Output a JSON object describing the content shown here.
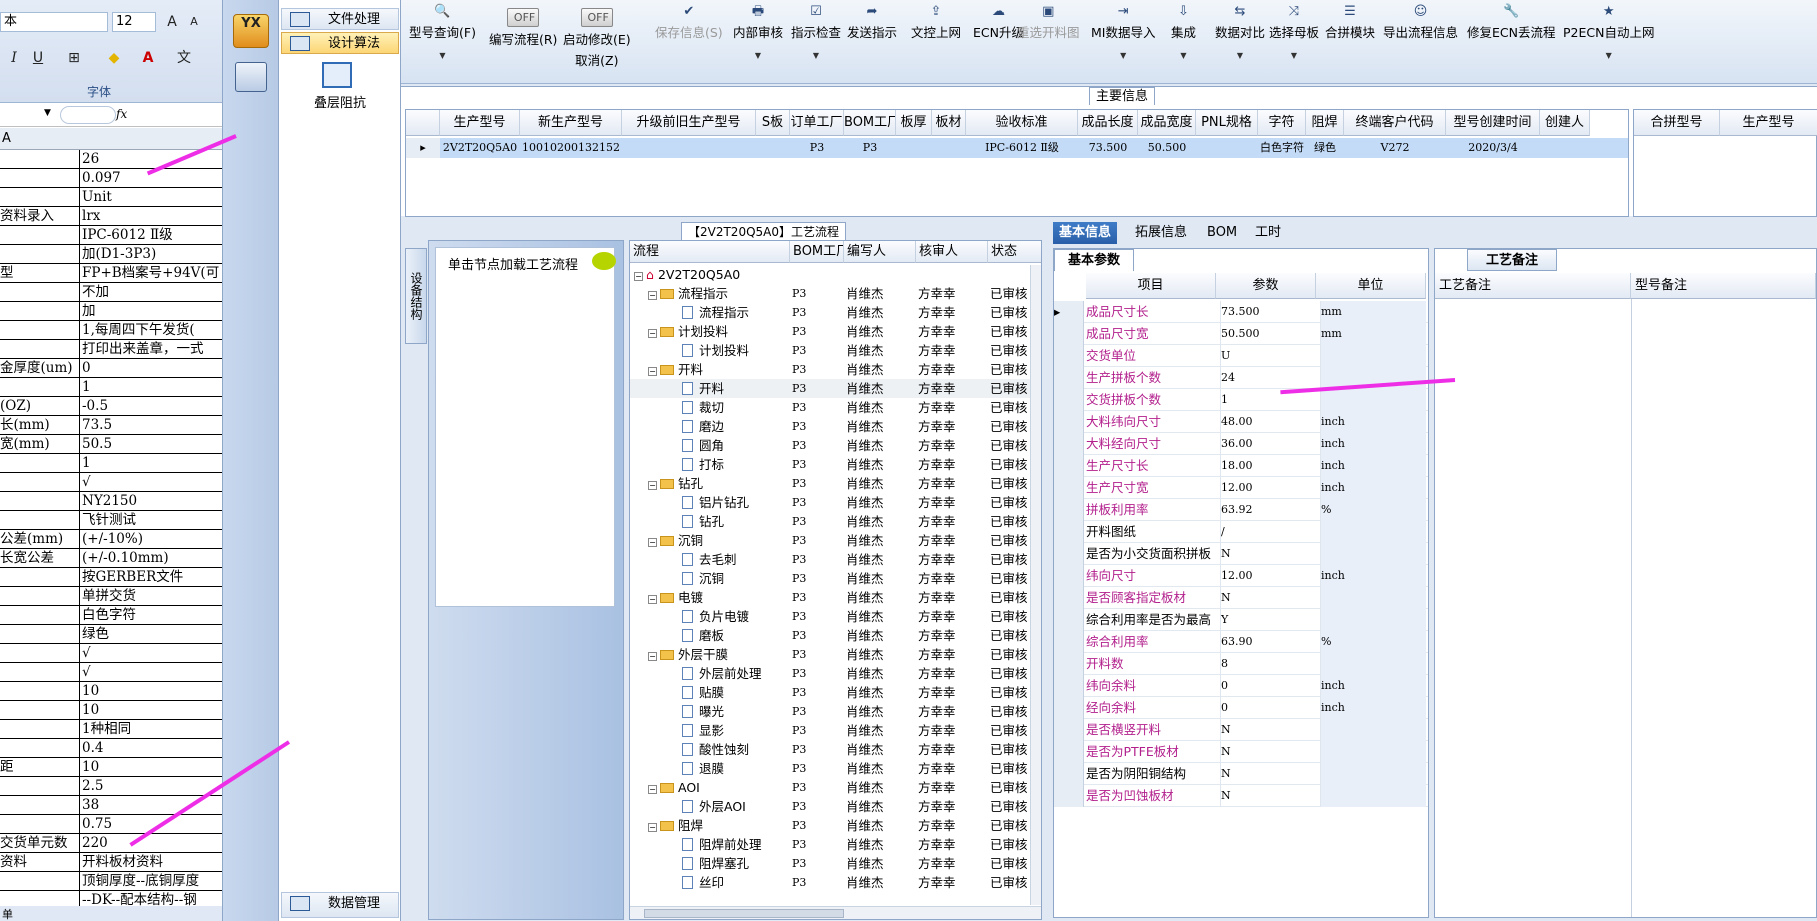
{
  "excel": {
    "font_name": "本",
    "font_size": "12",
    "font_group_label": "字体",
    "col_header": "A",
    "rows": [
      {
        "a": "",
        "b": "26"
      },
      {
        "a": "",
        "b": "0.097"
      },
      {
        "a": "",
        "b": "Unit"
      },
      {
        "a": "资料录入",
        "b": "lrx"
      },
      {
        "a": "",
        "b": "IPC-6012 Ⅱ级"
      },
      {
        "a": "",
        "b": "加(D1-3P3)"
      },
      {
        "a": "型",
        "b": "FP+B档案号+94V(可"
      },
      {
        "a": "",
        "b": "不加"
      },
      {
        "a": "",
        "b": "加"
      },
      {
        "a": "",
        "b": "1,每周四下午发货("
      },
      {
        "a": "",
        "b": "打印出来盖章，一式"
      },
      {
        "a": "金厚度(um)",
        "b": "0"
      },
      {
        "a": "",
        "b": "1"
      },
      {
        "a": "(OZ)",
        "b": "-0.5"
      },
      {
        "a": "长(mm)",
        "b": "73.5"
      },
      {
        "a": "宽(mm)",
        "b": "50.5"
      },
      {
        "a": "",
        "b": "1"
      },
      {
        "a": "",
        "b": "√"
      },
      {
        "a": "",
        "b": "NY2150"
      },
      {
        "a": "",
        "b": "飞针测试"
      },
      {
        "a": "公差(mm)",
        "b": "(+/-10%)"
      },
      {
        "a": "长宽公差",
        "b": "(+/-0.10mm)"
      },
      {
        "a": "",
        "b": "按GERBER文件"
      },
      {
        "a": "",
        "b": "单拼交货"
      },
      {
        "a": "",
        "b": "白色字符"
      },
      {
        "a": "",
        "b": "绿色"
      },
      {
        "a": "",
        "b": "√"
      },
      {
        "a": "",
        "b": "√"
      },
      {
        "a": "",
        "b": "10"
      },
      {
        "a": "",
        "b": "10"
      },
      {
        "a": "",
        "b": "1种相同"
      },
      {
        "a": "",
        "b": "0.4"
      },
      {
        "a": "距",
        "b": "10"
      },
      {
        "a": "",
        "b": "2.5"
      },
      {
        "a": "",
        "b": "38"
      },
      {
        "a": "",
        "b": "0.75"
      },
      {
        "a": "交货单元数",
        "b": "220"
      },
      {
        "a": "资料",
        "b": "开料板材资料"
      },
      {
        "a": "",
        "b": "顶铜厚度--底铜厚度"
      },
      {
        "a": "",
        "b": "--DK--配本结构--钢"
      }
    ],
    "sheet_tab": "单"
  },
  "nav": {
    "items": [
      "文件处理",
      "设计算法"
    ],
    "sub_item": "叠层阻抗",
    "bottom_item": "数据管理",
    "logo_text": "YX"
  },
  "toolbar": {
    "buttons": [
      {
        "icon": "🔍",
        "label": "型号查询(F)",
        "dd": true,
        "dis": false
      },
      {
        "icon": "",
        "label": "编写流程(R)",
        "dd": false,
        "dis": false,
        "toggle": "OFF"
      },
      {
        "icon": "",
        "label": "启动修改(E)",
        "sub": "取消(Z)",
        "dd": false,
        "dis": false,
        "toggle": "OFF"
      },
      {
        "icon": "✔",
        "label": "保存信息(S)",
        "dd": false,
        "dis": true
      },
      {
        "icon": "🖶",
        "label": "内部审核",
        "dd": true,
        "dis": false
      },
      {
        "icon": "☑",
        "label": "指示检查",
        "dd": true,
        "dis": false
      },
      {
        "icon": "➦",
        "label": "发送指示",
        "dd": false,
        "dis": false
      },
      {
        "icon": "⇪",
        "label": "文控上网",
        "dd": false,
        "dis": false
      },
      {
        "icon": "☁",
        "label": "ECN升级",
        "dd": false,
        "dis": false
      },
      {
        "icon": "▣",
        "label": "重选开料图",
        "dd": false,
        "dis": true
      },
      {
        "icon": "⇥",
        "label": "MI数据导入",
        "dd": true,
        "dis": false
      },
      {
        "icon": "⇩",
        "label": "集成",
        "dd": true,
        "dis": false
      },
      {
        "icon": "⇆",
        "label": "数据对比",
        "dd": true,
        "dis": false
      },
      {
        "icon": "⤨",
        "label": "选择母板",
        "dd": true,
        "dis": false
      },
      {
        "icon": "☰",
        "label": "合拼模块",
        "dd": false,
        "dis": false
      },
      {
        "icon": "☺",
        "label": "导出流程信息",
        "dd": false,
        "dis": false
      },
      {
        "icon": "🔧",
        "label": "修复ECN丢流程",
        "dd": false,
        "dis": false
      },
      {
        "icon": "★",
        "label": "P2ECN自动上网",
        "dd": true,
        "dis": false
      }
    ]
  },
  "main_info": {
    "title": "主要信息",
    "columns": [
      "生产型号",
      "新生产型号",
      "升级前旧生产型号",
      "S板",
      "订单工厂",
      "BOM工厂",
      "板厚",
      "板材",
      "验收标准",
      "成品长度",
      "成品宽度",
      "PNL规格",
      "字符",
      "阻焊",
      "终端客户代码",
      "型号创建时间",
      "创建人"
    ],
    "row": [
      "2V2T20Q5A0",
      "10010200132152",
      "",
      "",
      "P3",
      "P3",
      "",
      "",
      "IPC-6012 Ⅱ级",
      "73.500",
      "50.500",
      "",
      "白色字符",
      "绿色",
      "V272",
      "2020/3/4",
      ""
    ],
    "right_columns": [
      "合拼型号",
      "生产型号"
    ]
  },
  "process": {
    "vtab_label": "设备结构",
    "load_hint": "单击节点加载工艺流程",
    "title": "【2V2T20Q5A0】工艺流程",
    "columns": [
      "流程",
      "BOM工厂",
      "编写人",
      "核审人",
      "状态"
    ],
    "root": "2V2T20Q5A0",
    "rows": [
      {
        "name": "流程指示",
        "lvl": 1,
        "folder": true,
        "bom": "P3",
        "w": "肖维杰",
        "r": "方幸幸",
        "s": "已审核"
      },
      {
        "name": "流程指示",
        "lvl": 2,
        "folder": false,
        "bom": "P3",
        "w": "肖维杰",
        "r": "方幸幸",
        "s": "已审核"
      },
      {
        "name": "计划投料",
        "lvl": 1,
        "folder": true,
        "bom": "P3",
        "w": "肖维杰",
        "r": "方幸幸",
        "s": "已审核"
      },
      {
        "name": "计划投料",
        "lvl": 2,
        "folder": false,
        "bom": "P3",
        "w": "肖维杰",
        "r": "方幸幸",
        "s": "已审核"
      },
      {
        "name": "开料",
        "lvl": 1,
        "folder": true,
        "bom": "P3",
        "w": "肖维杰",
        "r": "方幸幸",
        "s": "已审核"
      },
      {
        "name": "开料",
        "lvl": 2,
        "folder": false,
        "bom": "P3",
        "w": "肖维杰",
        "r": "方幸幸",
        "s": "已审核"
      },
      {
        "name": "裁切",
        "lvl": 2,
        "folder": false,
        "bom": "P3",
        "w": "肖维杰",
        "r": "方幸幸",
        "s": "已审核"
      },
      {
        "name": "磨边",
        "lvl": 2,
        "folder": false,
        "bom": "P3",
        "w": "肖维杰",
        "r": "方幸幸",
        "s": "已审核"
      },
      {
        "name": "圆角",
        "lvl": 2,
        "folder": false,
        "bom": "P3",
        "w": "肖维杰",
        "r": "方幸幸",
        "s": "已审核"
      },
      {
        "name": "打标",
        "lvl": 2,
        "folder": false,
        "bom": "P3",
        "w": "肖维杰",
        "r": "方幸幸",
        "s": "已审核"
      },
      {
        "name": "钻孔",
        "lvl": 1,
        "folder": true,
        "bom": "P3",
        "w": "肖维杰",
        "r": "方幸幸",
        "s": "已审核"
      },
      {
        "name": "铝片钻孔",
        "lvl": 2,
        "folder": false,
        "bom": "P3",
        "w": "肖维杰",
        "r": "方幸幸",
        "s": "已审核"
      },
      {
        "name": "钻孔",
        "lvl": 2,
        "folder": false,
        "bom": "P3",
        "w": "肖维杰",
        "r": "方幸幸",
        "s": "已审核"
      },
      {
        "name": "沉铜",
        "lvl": 1,
        "folder": true,
        "bom": "P3",
        "w": "肖维杰",
        "r": "方幸幸",
        "s": "已审核"
      },
      {
        "name": "去毛刺",
        "lvl": 2,
        "folder": false,
        "bom": "P3",
        "w": "肖维杰",
        "r": "方幸幸",
        "s": "已审核"
      },
      {
        "name": "沉铜",
        "lvl": 2,
        "folder": false,
        "bom": "P3",
        "w": "肖维杰",
        "r": "方幸幸",
        "s": "已审核"
      },
      {
        "name": "电镀",
        "lvl": 1,
        "folder": true,
        "bom": "P3",
        "w": "肖维杰",
        "r": "方幸幸",
        "s": "已审核"
      },
      {
        "name": "负片电镀",
        "lvl": 2,
        "folder": false,
        "bom": "P3",
        "w": "肖维杰",
        "r": "方幸幸",
        "s": "已审核"
      },
      {
        "name": "磨板",
        "lvl": 2,
        "folder": false,
        "bom": "P3",
        "w": "肖维杰",
        "r": "方幸幸",
        "s": "已审核"
      },
      {
        "name": "外层干膜",
        "lvl": 1,
        "folder": true,
        "bom": "P3",
        "w": "肖维杰",
        "r": "方幸幸",
        "s": "已审核"
      },
      {
        "name": "外层前处理",
        "lvl": 2,
        "folder": false,
        "bom": "P3",
        "w": "肖维杰",
        "r": "方幸幸",
        "s": "已审核"
      },
      {
        "name": "贴膜",
        "lvl": 2,
        "folder": false,
        "bom": "P3",
        "w": "肖维杰",
        "r": "方幸幸",
        "s": "已审核"
      },
      {
        "name": "曝光",
        "lvl": 2,
        "folder": false,
        "bom": "P3",
        "w": "肖维杰",
        "r": "方幸幸",
        "s": "已审核"
      },
      {
        "name": "显影",
        "lvl": 2,
        "folder": false,
        "bom": "P3",
        "w": "肖维杰",
        "r": "方幸幸",
        "s": "已审核"
      },
      {
        "name": "酸性蚀刻",
        "lvl": 2,
        "folder": false,
        "bom": "P3",
        "w": "肖维杰",
        "r": "方幸幸",
        "s": "已审核"
      },
      {
        "name": "退膜",
        "lvl": 2,
        "folder": false,
        "bom": "P3",
        "w": "肖维杰",
        "r": "方幸幸",
        "s": "已审核"
      },
      {
        "name": "AOI",
        "lvl": 1,
        "folder": true,
        "bom": "P3",
        "w": "肖维杰",
        "r": "方幸幸",
        "s": "已审核"
      },
      {
        "name": "外层AOI",
        "lvl": 2,
        "folder": false,
        "bom": "P3",
        "w": "肖维杰",
        "r": "方幸幸",
        "s": "已审核"
      },
      {
        "name": "阻焊",
        "lvl": 1,
        "folder": true,
        "bom": "P3",
        "w": "肖维杰",
        "r": "方幸幸",
        "s": "已审核"
      },
      {
        "name": "阻焊前处理",
        "lvl": 2,
        "folder": false,
        "bom": "P3",
        "w": "肖维杰",
        "r": "方幸幸",
        "s": "已审核"
      },
      {
        "name": "阻焊塞孔",
        "lvl": 2,
        "folder": false,
        "bom": "P3",
        "w": "肖维杰",
        "r": "方幸幸",
        "s": "已审核"
      },
      {
        "name": "丝印",
        "lvl": 2,
        "folder": false,
        "bom": "P3",
        "w": "肖维杰",
        "r": "方幸幸",
        "s": "已审核"
      }
    ]
  },
  "basic": {
    "tabs": [
      "基本信息",
      "拓展信息",
      "BOM",
      "工时"
    ],
    "sub_tab": "基本参数",
    "columns": [
      "项目",
      "参数",
      "单位"
    ],
    "rows": [
      {
        "k": "成品尺寸长",
        "v": "73.500",
        "u": "mm",
        "pink": true
      },
      {
        "k": "成品尺寸宽",
        "v": "50.500",
        "u": "mm",
        "pink": true
      },
      {
        "k": "交货单位",
        "v": "U",
        "u": "",
        "pink": true
      },
      {
        "k": "生产拼板个数",
        "v": "24",
        "u": "",
        "pink": true
      },
      {
        "k": "交货拼板个数",
        "v": "1",
        "u": "",
        "pink": true
      },
      {
        "k": "大料纬向尺寸",
        "v": "48.00",
        "u": "inch",
        "pink": true
      },
      {
        "k": "大料经向尺寸",
        "v": "36.00",
        "u": "inch",
        "pink": true
      },
      {
        "k": "生产尺寸长",
        "v": "18.00",
        "u": "inch",
        "pink": true
      },
      {
        "k": "生产尺寸宽",
        "v": "12.00",
        "u": "inch",
        "pink": true
      },
      {
        "k": "拼板利用率",
        "v": "63.92",
        "u": "%",
        "pink": true
      },
      {
        "k": "开料图纸",
        "v": "/",
        "u": "",
        "pink": false
      },
      {
        "k": "是否为小交货面积拼板",
        "v": "N",
        "u": "",
        "pink": false
      },
      {
        "k": "纬向尺寸",
        "v": "12.00",
        "u": "inch",
        "pink": true
      },
      {
        "k": "是否顾客指定板材",
        "v": "N",
        "u": "",
        "pink": true
      },
      {
        "k": "综合利用率是否为最高",
        "v": "Y",
        "u": "",
        "pink": false
      },
      {
        "k": "综合利用率",
        "v": "63.90",
        "u": "%",
        "pink": true
      },
      {
        "k": "开料数",
        "v": "8",
        "u": "",
        "pink": true
      },
      {
        "k": "纬向余料",
        "v": "0",
        "u": "inch",
        "pink": true
      },
      {
        "k": "经向余料",
        "v": "0",
        "u": "inch",
        "pink": true
      },
      {
        "k": "是否横竖开料",
        "v": "N",
        "u": "",
        "pink": true
      },
      {
        "k": "是否为PTFE板材",
        "v": "N",
        "u": "",
        "pink": true
      },
      {
        "k": "是否为阴阳铜结构",
        "v": "N",
        "u": "",
        "pink": false
      },
      {
        "k": "是否为凹蚀板材",
        "v": "N",
        "u": "",
        "pink": true
      }
    ]
  },
  "remarks": {
    "title": "工艺备注",
    "columns": [
      "工艺备注",
      "型号备注"
    ]
  }
}
